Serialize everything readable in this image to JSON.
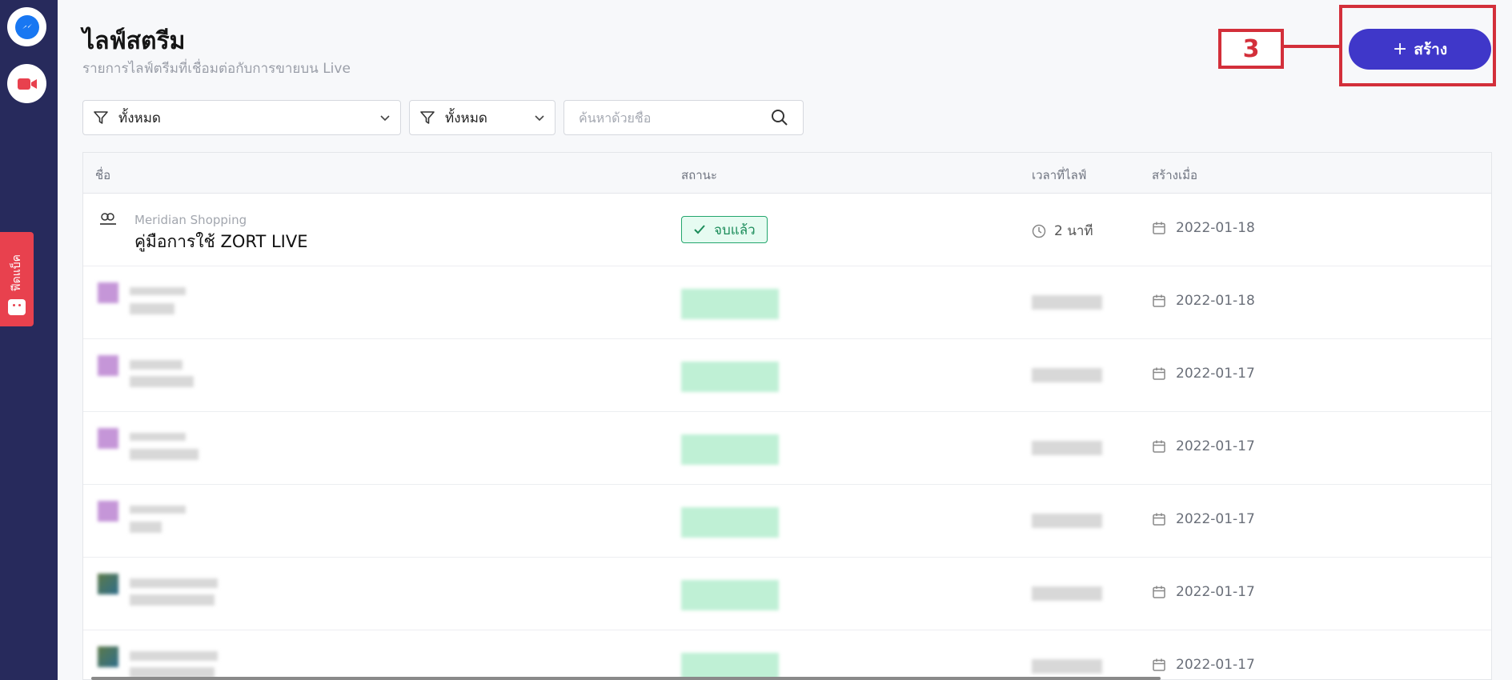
{
  "page": {
    "title": "ไลฟ์สตรีม",
    "subtitle": "รายการไลฟ์ตรีมที่เชื่อมต่อกับการขายบน Live"
  },
  "sidebar": {
    "icons": [
      "messenger-icon",
      "video-camera-icon"
    ],
    "feedback_label": "ฟีดแบ็ค"
  },
  "actions": {
    "create_label": "สร้าง",
    "create_plus": "+"
  },
  "annotation": {
    "step_number": "3",
    "color": "#d32f3a"
  },
  "filters": {
    "filter1_value": "ทั้งหมด",
    "filter2_value": "ทั้งหมด",
    "search_placeholder": "ค้นหาด้วยชื่อ"
  },
  "table": {
    "headers": {
      "name": "ชื่อ",
      "status": "สถานะ",
      "live_time": "เวลาที่ไลฟ์",
      "created_at": "สร้างเมื่อ"
    },
    "rows": [
      {
        "shop": "Meridian Shopping",
        "title": "คู่มือการใช้ ZORT LIVE",
        "status": "จบแล้ว",
        "duration": "2 นาที",
        "created": "2022-01-18"
      },
      {
        "created": "2022-01-18"
      },
      {
        "created": "2022-01-17"
      },
      {
        "created": "2022-01-17"
      },
      {
        "created": "2022-01-17"
      },
      {
        "created": "2022-01-17"
      },
      {
        "created": "2022-01-17"
      }
    ]
  },
  "colors": {
    "sidebar": "#272a5c",
    "primary": "#3f37c9",
    "status_green": "#23a66d",
    "feedback": "#e8414e"
  }
}
